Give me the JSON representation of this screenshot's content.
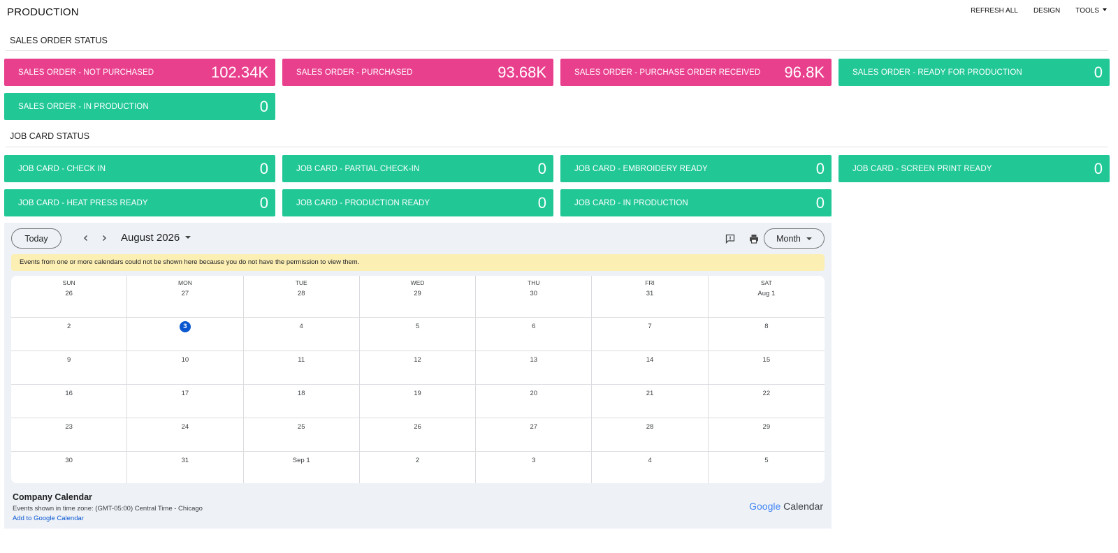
{
  "header": {
    "title": "PRODUCTION",
    "actions": [
      "REFRESH ALL",
      "DESIGN",
      "TOOLS"
    ]
  },
  "sales_section": {
    "title": "SALES ORDER STATUS",
    "tiles": [
      {
        "label": "SALES ORDER - NOT PURCHASED",
        "value": "102.34K",
        "color": "#e9408e"
      },
      {
        "label": "SALES ORDER - PURCHASED",
        "value": "93.68K",
        "color": "#e9408e"
      },
      {
        "label": "SALES ORDER - PURCHASE ORDER RECEIVED",
        "value": "96.8K",
        "color": "#e9408e"
      },
      {
        "label": "SALES ORDER - READY FOR PRODUCTION",
        "value": "0",
        "color": "#21c896"
      },
      {
        "label": "SALES ORDER - IN PRODUCTION",
        "value": "0",
        "color": "#21c896"
      }
    ]
  },
  "job_section": {
    "title": "JOB CARD STATUS",
    "tiles": [
      {
        "label": "JOB CARD - CHECK IN",
        "value": "0",
        "color": "#21c896"
      },
      {
        "label": "JOB CARD - PARTIAL CHECK-IN",
        "value": "0",
        "color": "#21c896"
      },
      {
        "label": "JOB CARD - EMBROIDERY READY",
        "value": "0",
        "color": "#21c896"
      },
      {
        "label": "JOB CARD - SCREEN PRINT READY",
        "value": "0",
        "color": "#21c896"
      },
      {
        "label": "JOB CARD - HEAT PRESS READY",
        "value": "0",
        "color": "#21c896"
      },
      {
        "label": "JOB CARD - PRODUCTION READY",
        "value": "0",
        "color": "#21c896"
      },
      {
        "label": "JOB CARD - IN PRODUCTION",
        "value": "0",
        "color": "#21c896"
      }
    ]
  },
  "calendar": {
    "today_label": "Today",
    "prev_icon": "chevron-left-icon",
    "next_icon": "chevron-right-icon",
    "month_label": "August 2026",
    "view_label": "Month",
    "warning": "Events from one or more calendars could not be shown here because you do not have the permission to view them.",
    "weekdays": [
      "SUN",
      "MON",
      "TUE",
      "WED",
      "THU",
      "FRI",
      "SAT"
    ],
    "weeks": [
      [
        "26",
        "27",
        "28",
        "29",
        "30",
        "31",
        "Aug 1"
      ],
      [
        "2",
        "3",
        "4",
        "5",
        "6",
        "7",
        "8"
      ],
      [
        "9",
        "10",
        "11",
        "12",
        "13",
        "14",
        "15"
      ],
      [
        "16",
        "17",
        "18",
        "19",
        "20",
        "21",
        "22"
      ],
      [
        "23",
        "24",
        "25",
        "26",
        "27",
        "28",
        "29"
      ],
      [
        "30",
        "31",
        "Sep 1",
        "2",
        "3",
        "4",
        "5"
      ]
    ],
    "today": "3",
    "calendar_name": "Company Calendar",
    "timezone_text": "Events shown in time zone: (GMT-05:00) Central Time - Chicago",
    "add_link": "Add to Google Calendar",
    "brand": {
      "google": "Google",
      "calendar": "Calendar"
    }
  }
}
